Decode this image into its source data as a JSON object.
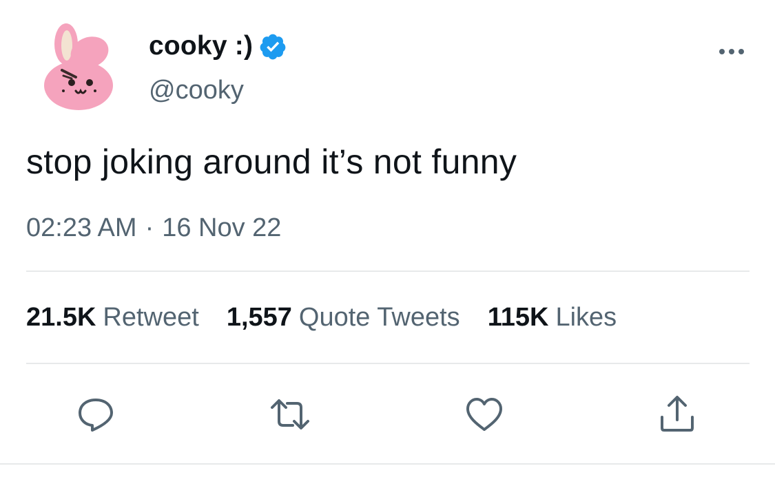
{
  "author": {
    "display_name": "cooky :)",
    "handle": "@cooky",
    "verified": true,
    "avatar_icon": "bunny-avatar",
    "avatar_color": "#f5a3bd",
    "verified_color": "#1d9bf0"
  },
  "tweet": {
    "text": "stop joking around it’s not funny",
    "time": "02:23 AM",
    "separator": "·",
    "date": "16 Nov 22"
  },
  "stats": [
    {
      "value": "21.5K",
      "label": "Retweet"
    },
    {
      "value": "1,557",
      "label": "Quote Tweets"
    },
    {
      "value": "115K",
      "label": "Likes"
    }
  ],
  "actions": [
    {
      "icon": "reply-icon"
    },
    {
      "icon": "retweet-icon"
    },
    {
      "icon": "like-icon"
    },
    {
      "icon": "share-icon"
    }
  ],
  "colors": {
    "primary_text": "#0f1419",
    "secondary_text": "#536471",
    "divider": "#e7e9ea"
  }
}
